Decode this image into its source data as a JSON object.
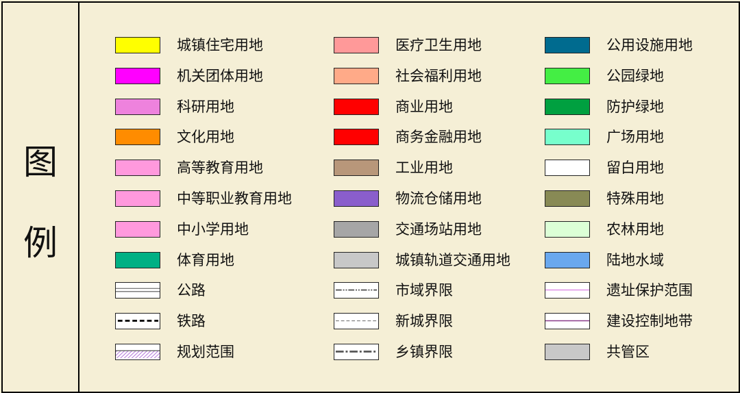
{
  "legend": {
    "title": [
      "图",
      "例"
    ],
    "columns": [
      [
        {
          "label": "城镇住宅用地",
          "color": "#ffff00",
          "icon": "yellow-fill-swatch"
        },
        {
          "label": "机关团体用地",
          "color": "#ff00ff",
          "icon": "magenta-fill-swatch"
        },
        {
          "label": "科研用地",
          "color": "#ee82dd",
          "icon": "orchid-fill-swatch"
        },
        {
          "label": "文化用地",
          "color": "#ff8c00",
          "icon": "orange-fill-swatch"
        },
        {
          "label": "高等教育用地",
          "color": "#ff99dd",
          "icon": "pink-fill-swatch"
        },
        {
          "label": "中等职业教育用地",
          "color": "#ff99dd",
          "icon": "pink-fill-swatch"
        },
        {
          "label": "中小学用地",
          "color": "#ff99dd",
          "icon": "pink-fill-swatch"
        },
        {
          "label": "体育用地",
          "color": "#00b084",
          "icon": "teal-fill-swatch"
        },
        {
          "label": "公路",
          "color": "#ffffff",
          "icon": "highway-double-line-icon"
        },
        {
          "label": "铁路",
          "color": "#ffffff",
          "icon": "railway-dashed-line-icon"
        },
        {
          "label": "规划范围",
          "color": "#ffffff",
          "icon": "planning-boundary-hatch-icon"
        }
      ],
      [
        {
          "label": "医疗卫生用地",
          "color": "#ff9999",
          "icon": "salmon-fill-swatch"
        },
        {
          "label": "社会福利用地",
          "color": "#ffaa88",
          "icon": "peach-fill-swatch"
        },
        {
          "label": "商业用地",
          "color": "#ff0000",
          "icon": "red-fill-swatch"
        },
        {
          "label": "商务金融用地",
          "color": "#ff0000",
          "icon": "red-fill-swatch"
        },
        {
          "label": "工业用地",
          "color": "#b8977a",
          "icon": "tan-fill-swatch"
        },
        {
          "label": "物流仓储用地",
          "color": "#8a5ecc",
          "icon": "purple-fill-swatch"
        },
        {
          "label": "交通场站用地",
          "color": "#a6a6a6",
          "icon": "gray-fill-swatch"
        },
        {
          "label": "城镇轨道交通用地",
          "color": "#c8c8c8",
          "icon": "light-gray-fill-swatch"
        },
        {
          "label": "市域界限",
          "color": "#ffffff",
          "icon": "city-boundary-dash-dot-icon"
        },
        {
          "label": "新城界限",
          "color": "#ffffff",
          "icon": "new-town-boundary-dashed-icon"
        },
        {
          "label": "乡镇界限",
          "color": "#ffffff",
          "icon": "township-boundary-dash-dot-icon"
        }
      ],
      [
        {
          "label": "公用设施用地",
          "color": "#006b8f",
          "icon": "dark-teal-fill-swatch"
        },
        {
          "label": "公园绿地",
          "color": "#44ee44",
          "icon": "bright-green-fill-swatch"
        },
        {
          "label": "防护绿地",
          "color": "#00a040",
          "icon": "green-fill-swatch"
        },
        {
          "label": "广场用地",
          "color": "#77ffcc",
          "icon": "aquamarine-fill-swatch"
        },
        {
          "label": "留白用地",
          "color": "#ffffff",
          "icon": "white-fill-swatch"
        },
        {
          "label": "特殊用地",
          "color": "#888a55",
          "icon": "olive-fill-swatch"
        },
        {
          "label": "农林用地",
          "color": "#dcffd6",
          "icon": "pale-green-fill-swatch"
        },
        {
          "label": "陆地水域",
          "color": "#6aa8ee",
          "icon": "blue-fill-swatch"
        },
        {
          "label": "遗址保护范围",
          "color": "#ffffff",
          "icon": "heritage-protection-line-icon"
        },
        {
          "label": "建设控制地带",
          "color": "#ffffff",
          "icon": "construction-control-line-icon"
        },
        {
          "label": "共管区",
          "color": "#c8c8c8",
          "icon": "light-gray-fill-swatch"
        }
      ]
    ],
    "line_colors": {
      "road": "#555555",
      "boundary": "#555555",
      "hatch": "#b070d8",
      "heritage": "#e090e8",
      "control": "#8a3a8a"
    }
  }
}
